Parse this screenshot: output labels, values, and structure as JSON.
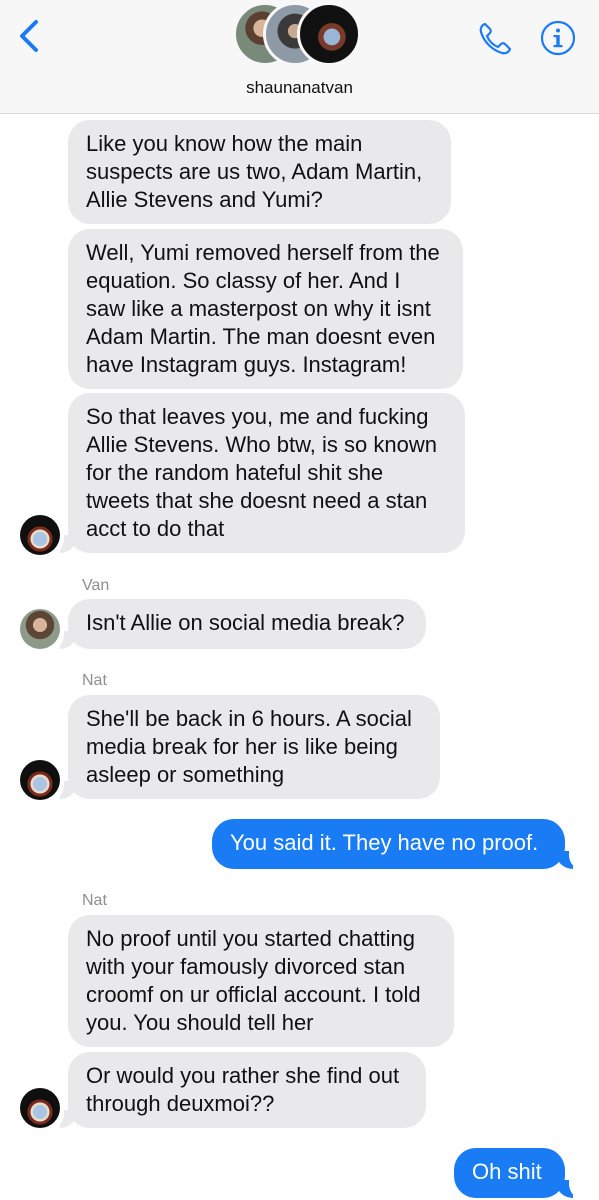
{
  "header": {
    "contact_name": "shaunanatvan"
  },
  "participants": {
    "van_label": "Van",
    "nat_label": "Nat"
  },
  "messages": [
    {
      "from": "in",
      "text": "Like you know how the main suspects are us two, Adam Martin, Allie Stevens and Yumi?"
    },
    {
      "from": "in",
      "text": "Well, Yumi removed herself from the equation. So classy of her. And I saw like a masterpost on why it isnt Adam Martin. The man doesnt even have Instagram guys. Instagram!"
    },
    {
      "from": "in",
      "text": "So that leaves you, me and fucking Allie Stevens. Who btw, is so known for the random hateful shit she tweets that she doesnt need a stan acct to do that"
    },
    {
      "from": "in",
      "sender": "Van",
      "text": "Isn't Allie on social media break?"
    },
    {
      "from": "in",
      "sender": "Nat",
      "text": "She'll be back in 6 hours. A social media break for her is like being asleep or something"
    },
    {
      "from": "out",
      "text": "You said it. They have no proof."
    },
    {
      "from": "in",
      "sender": "Nat",
      "text": "No proof until you  started chatting with your famously divorced stan croomf on ur  officlal account. I told you. You should tell her"
    },
    {
      "from": "in",
      "text": "Or would you rather she find out through deuxmoi??"
    },
    {
      "from": "out",
      "text": "Oh shit"
    }
  ],
  "colors": {
    "accent_blue": "#1a7cf5",
    "incoming_bubble": "#e9e9eb",
    "sender_label": "#8e8e93"
  },
  "icons": {
    "back": "chevron-left-icon",
    "call": "phone-icon",
    "info": "info-icon"
  }
}
